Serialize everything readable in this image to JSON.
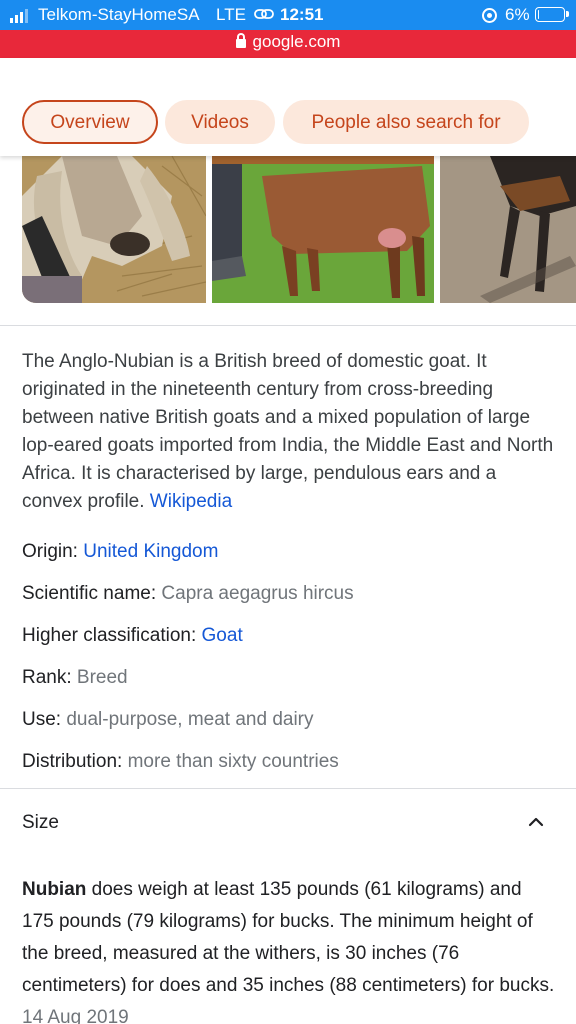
{
  "status": {
    "carrier": "Telkom-StayHomeSA",
    "network": "LTE",
    "time": "12:51",
    "battery": "6%",
    "battery_level": 0.06,
    "signal_bars": 3,
    "color": "#1a8cf0"
  },
  "browser": {
    "domain": "google.com",
    "color": "#e8283a"
  },
  "tabs": [
    "Overview",
    "Videos",
    "People also search for"
  ],
  "active_tab": "Overview",
  "description": {
    "text": "The Anglo-Nubian is a British breed of domestic goat. It originated in the nineteenth century from cross-breeding between native British goats and a mixed population of large lop-eared goats imported from India, the Middle East and North Africa. It is characterised by large, pendulous ears and a convex profile.",
    "source": "Wikipedia"
  },
  "facts": [
    {
      "label": "Origin:",
      "value": "United Kingdom",
      "link": true
    },
    {
      "label": "Scientific name:",
      "value": "Capra aegagrus hircus",
      "link": false
    },
    {
      "label": "Higher classification:",
      "value": "Goat",
      "link": true
    },
    {
      "label": "Rank:",
      "value": "Breed",
      "link": false
    },
    {
      "label": "Use:",
      "value": "dual-purpose, meat and dairy",
      "link": false
    },
    {
      "label": "Distribution:",
      "value": "more than sixty countries",
      "link": false
    }
  ],
  "size": {
    "heading": "Size",
    "subject": "Nubian",
    "text": "does weigh at least 135 pounds (61 kilograms) and 175 pounds (79 kilograms) for bucks. The minimum height of the breed, measured at the withers, is 30 inches (76 centimeters) for does and 35 inches (88 centimeters) for bucks.",
    "date": "14 Aug 2019"
  },
  "icons": {
    "lock": "lock-icon",
    "chevron": "chevron-up-icon",
    "hotspot": "link-icon",
    "orientation_lock": "orientation-lock-icon",
    "battery": "battery-icon",
    "signal": "signal-icon"
  },
  "accent_color": "#c5451c",
  "link_color": "#1558d6"
}
